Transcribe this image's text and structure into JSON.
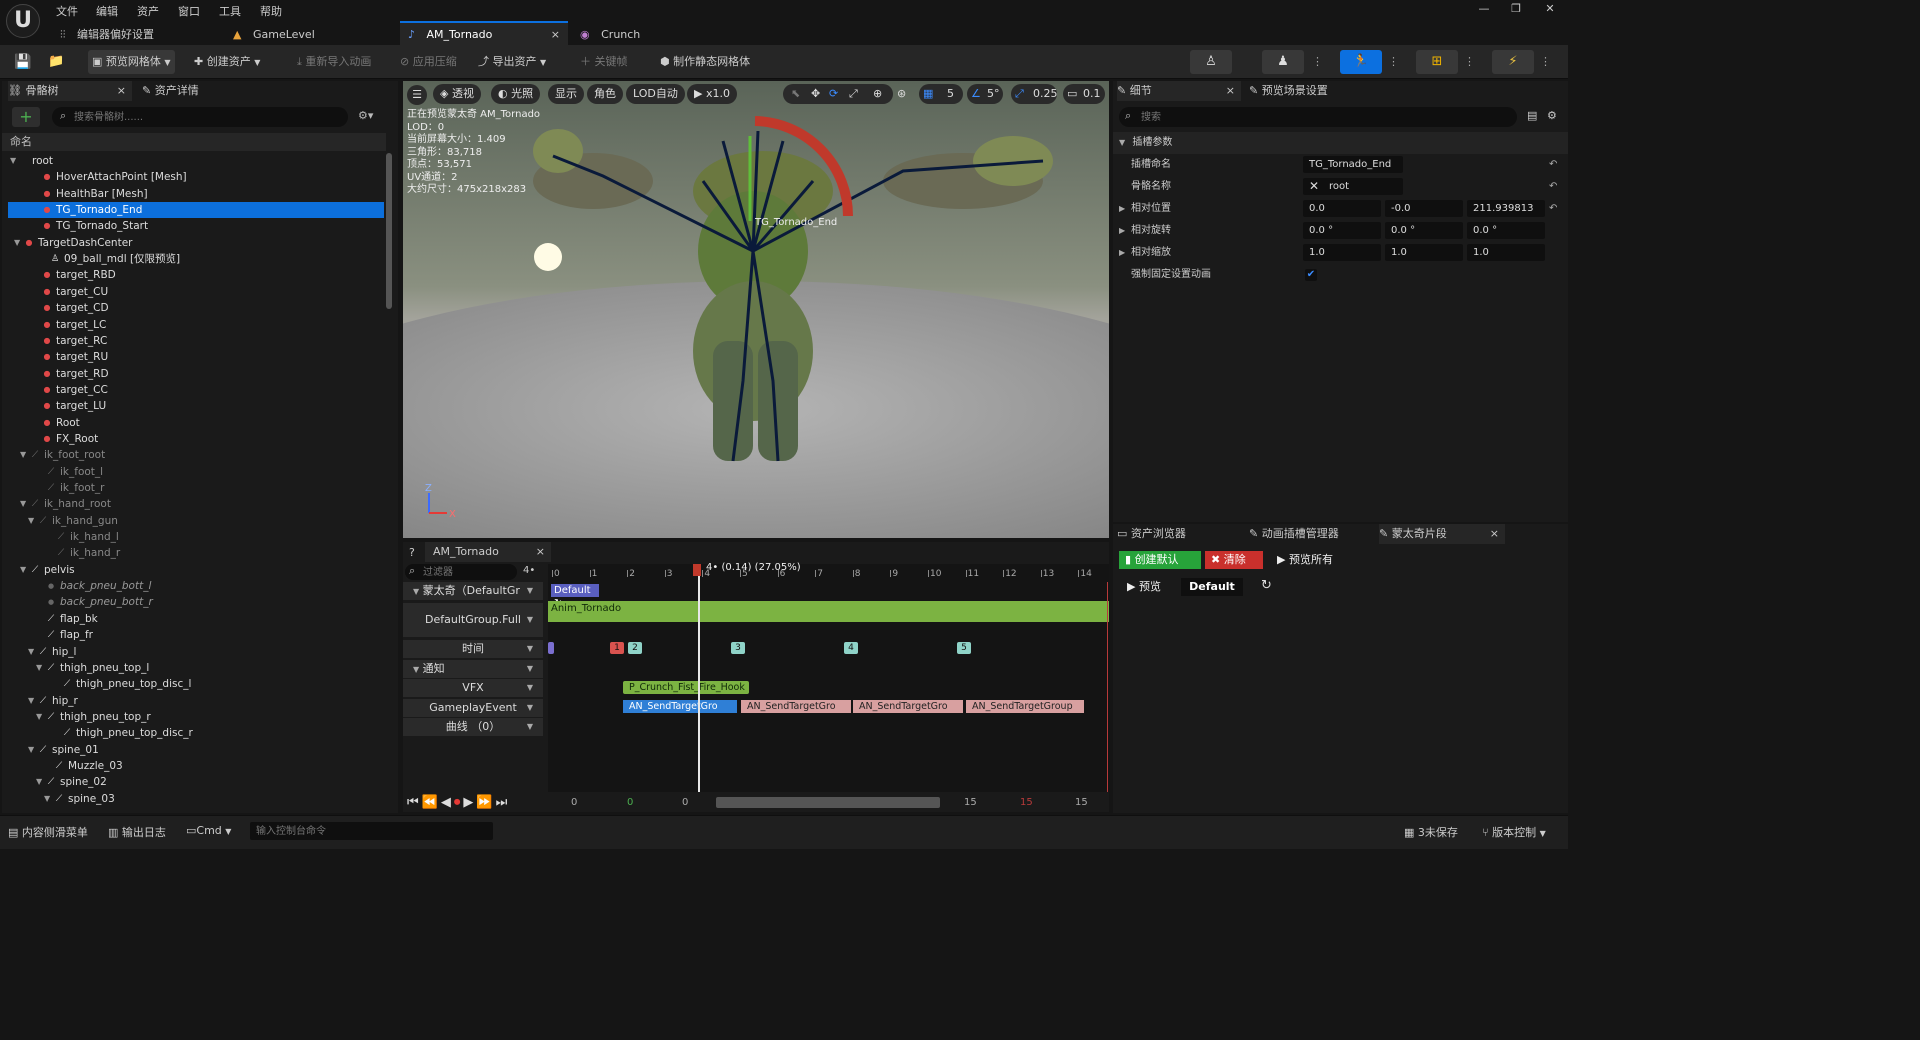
{
  "menu": {
    "items": [
      "文件",
      "编辑",
      "资产",
      "窗口",
      "工具",
      "帮助"
    ]
  },
  "tabs": [
    {
      "label": "编辑器偏好设置"
    },
    {
      "label": "GameLevel"
    },
    {
      "label": "AM_Tornado"
    },
    {
      "label": "Crunch"
    }
  ],
  "toolbar": {
    "preview_mesh": "预览网格体",
    "create_asset": "创建资产",
    "reimport": "重新导入动画",
    "apply_compression": "应用压缩",
    "export_asset": "导出资产",
    "keyframe": "关键帧",
    "make_static_mesh": "制作静态网格体"
  },
  "left": {
    "tab_skeleton": "骨骼树",
    "tab_asset_details": "资产详情",
    "search_placeholder": "搜索骨骼树......",
    "column_name": "命名",
    "rows": [
      {
        "label": "root"
      },
      {
        "label": "HoverAttachPoint [Mesh]"
      },
      {
        "label": "HealthBar [Mesh]"
      },
      {
        "label": "TG_Tornado_End"
      },
      {
        "label": "TG_Tornado_Start"
      },
      {
        "label": "TargetDashCenter"
      },
      {
        "label": "09_ball_mdl [仅限预览]"
      },
      {
        "label": "target_RBD"
      },
      {
        "label": "target_CU"
      },
      {
        "label": "target_CD"
      },
      {
        "label": "target_LC"
      },
      {
        "label": "target_RC"
      },
      {
        "label": "target_RU"
      },
      {
        "label": "target_RD"
      },
      {
        "label": "target_CC"
      },
      {
        "label": "target_LU"
      },
      {
        "label": "Root"
      },
      {
        "label": "FX_Root"
      },
      {
        "label": "ik_foot_root"
      },
      {
        "label": "ik_foot_l"
      },
      {
        "label": "ik_foot_r"
      },
      {
        "label": "ik_hand_root"
      },
      {
        "label": "ik_hand_gun"
      },
      {
        "label": "ik_hand_l"
      },
      {
        "label": "ik_hand_r"
      },
      {
        "label": "pelvis"
      },
      {
        "label": "back_pneu_bott_l"
      },
      {
        "label": "back_pneu_bott_r"
      },
      {
        "label": "flap_bk"
      },
      {
        "label": "flap_fr"
      },
      {
        "label": "hip_l"
      },
      {
        "label": "thigh_pneu_top_l"
      },
      {
        "label": "thigh_pneu_top_disc_l"
      },
      {
        "label": "hip_r"
      },
      {
        "label": "thigh_pneu_top_r"
      },
      {
        "label": "thigh_pneu_top_disc_r"
      },
      {
        "label": "spine_01"
      },
      {
        "label": "Muzzle_03"
      },
      {
        "label": "spine_02"
      },
      {
        "label": "spine_03"
      }
    ]
  },
  "viewport": {
    "btn_perspective": "透视",
    "btn_lit": "光照",
    "btn_show": "显示",
    "btn_character": "角色",
    "btn_lod": "LOD自动",
    "btn_speed": "x1.0",
    "grid_value": "5",
    "angle_value": "5°",
    "scale_value": "0.25",
    "camera_value": "0.1",
    "stats": [
      "正在预览蒙太奇 AM_Tornado",
      "LOD：0",
      "当前屏幕大小：1.409",
      "三角形：83,718",
      "顶点：53,571",
      "UV通道：2",
      "大约尺寸：475x218x283"
    ],
    "socket_label": "TG_Tornado_End"
  },
  "details": {
    "tab_details": "细节",
    "tab_preview_scene": "预览场景设置",
    "search_placeholder": "搜索",
    "section_title": "插槽参数",
    "socket_name_label": "插槽命名",
    "socket_name_value": "TG_Tornado_End",
    "bone_name_label": "骨骼名称",
    "bone_name_value": "root",
    "rel_loc_label": "相对位置",
    "rel_loc": [
      "0.0",
      "-0.0",
      "211.939813"
    ],
    "rel_rot_label": "相对旋转",
    "rel_rot": [
      "0.0 °",
      "0.0 °",
      "0.0 °"
    ],
    "rel_scale_label": "相对缩放",
    "rel_scale": [
      "1.0",
      "1.0",
      "1.0"
    ],
    "force_label": "强制固定设置动画",
    "force_checked": true
  },
  "browser": {
    "tab_asset_browser": "资产浏览器",
    "tab_slot_manager": "动画插槽管理器",
    "tab_montage_sections": "蒙太奇片段",
    "btn_create_default": "创建默认",
    "btn_clear": "清除",
    "btn_preview_all": "预览所有",
    "btn_preview": "预览",
    "default_label": "Default"
  },
  "timeline": {
    "tab_title": "AM_Tornado",
    "filter_placeholder": "过滤器",
    "frame_btn": "4•",
    "playhead_label": "4• (0.14) (27.05%)",
    "ruler": [
      "0",
      "1",
      "2",
      "3",
      "4",
      "5",
      "6",
      "7",
      "8",
      "9",
      "10",
      "11",
      "12",
      "13",
      "14"
    ],
    "montage_track": "蒙太奇（DefaultGr",
    "slot_track": "DefaultGroup.Full",
    "time_track": "时间",
    "notify_track": "通知",
    "vfx_track": "VFX",
    "gameplay_track": "GameplayEvent",
    "curve_track": "曲线 （0）",
    "section_default": "Default",
    "anim_segment": "Anim_Tornado",
    "time_markers": [
      "1",
      "2",
      "3",
      "4",
      "5"
    ],
    "vfx_notify": "P_Crunch_Fist_Fire_Hook",
    "gameplay_notifies": [
      "AN_SendTargetGro",
      "AN_SendTargetGro",
      "AN_SendTargetGro",
      "AN_SendTargetGroup"
    ],
    "bottom_values": [
      "0",
      "0",
      "0",
      "15",
      "15",
      "15"
    ]
  },
  "statusbar": {
    "content_drawer": "内容侧滑菜单",
    "output_log": "输出日志",
    "cmd": "Cmd",
    "console_placeholder": "输入控制台命令",
    "unsaved": "3未保存",
    "version_control": "版本控制"
  },
  "colors": {
    "accent": "#0c70e0",
    "selection": "#0c6fdc",
    "montage_green": "#7cb342",
    "red": "#c9302c",
    "ok_green": "#27a33a"
  }
}
